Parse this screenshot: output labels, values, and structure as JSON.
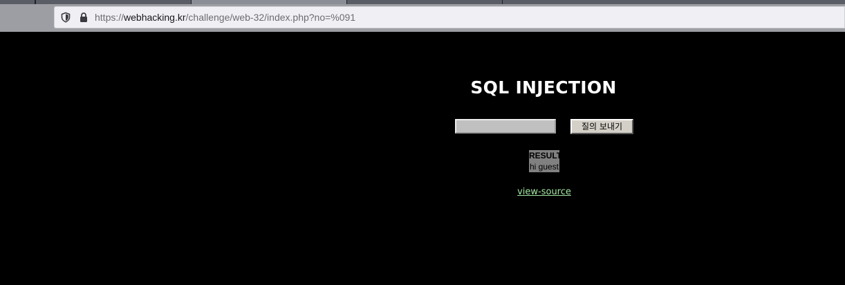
{
  "browser": {
    "url_prefix": "https://",
    "url_host": "webhacking.kr",
    "url_path": "/challenge/web-32/index.php?no=%091",
    "icons": [
      "shield-icon",
      "lock-icon"
    ]
  },
  "page": {
    "title": "SQL INJECTION",
    "query_input_value": "",
    "submit_label": "질의 보내기",
    "result_heading": "RESULT",
    "result_text": "hi guest",
    "view_source_label": "view-source"
  },
  "colors": {
    "background": "#000000",
    "link": "#a3e6a3",
    "result_bg": "#808080"
  }
}
